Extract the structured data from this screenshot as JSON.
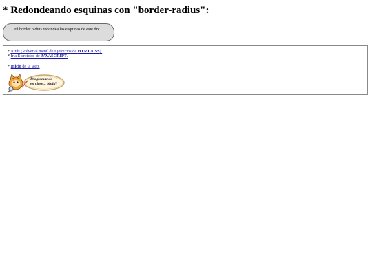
{
  "heading": "* Redondeando esquinas con \"border-radius\":",
  "demo_box": {
    "text": "El border radius redondea las esquinas de este div."
  },
  "nav": {
    "line1": {
      "prefix": "* ",
      "link": "Atrás (Volver al menú de Ejercicios de ",
      "link_bold": "HTML/CSS",
      "suffix": ")."
    },
    "line2": {
      "prefix": "* ",
      "link": "Ir a Ejercicios de ",
      "link_bold": "JAVASCRIPT",
      "suffix": "."
    },
    "line3": {
      "prefix": "* ",
      "link_bold": "Inicio",
      "link": " de la web."
    }
  },
  "logo": {
    "line1": "Programando",
    "line2": "en clase... Moltf!"
  }
}
